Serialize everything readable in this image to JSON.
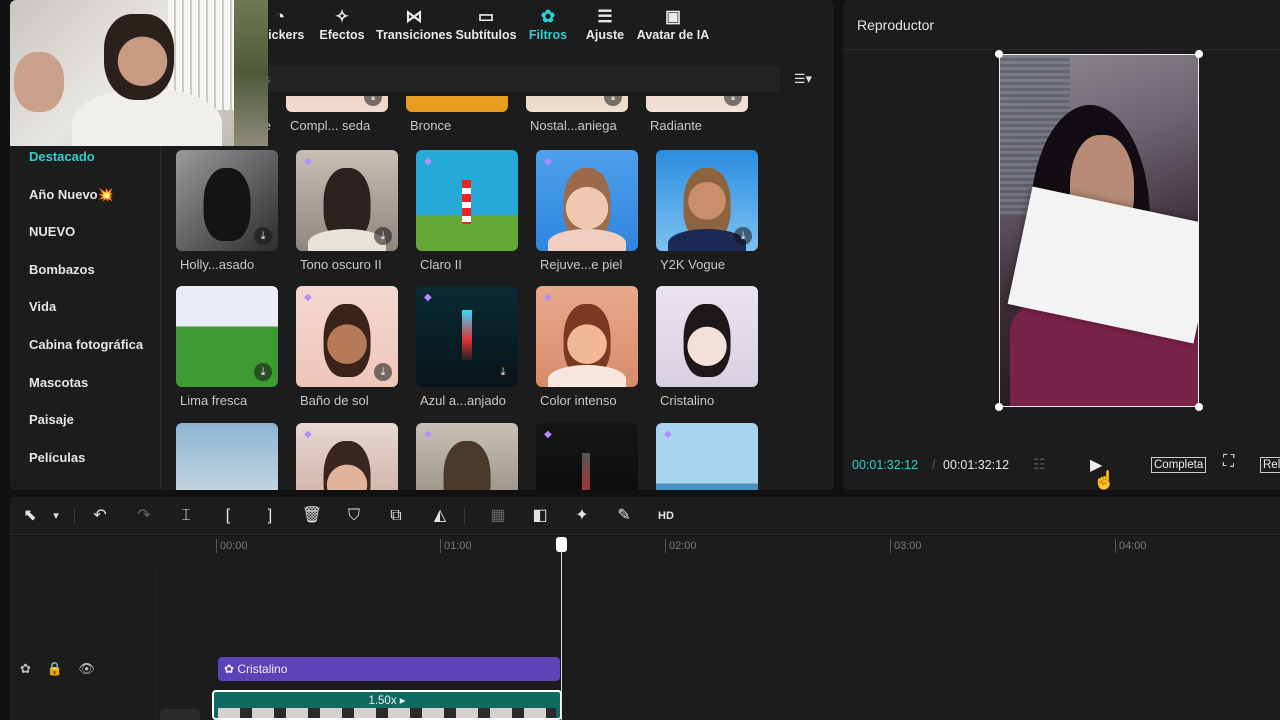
{
  "tabs": [
    {
      "label": "Stickers",
      "icon": "sticker-icon",
      "glyph": "◔"
    },
    {
      "label": "Efectos",
      "icon": "effects-icon",
      "glyph": "✧"
    },
    {
      "label": "Transiciones",
      "icon": "transitions-icon",
      "glyph": "⋈"
    },
    {
      "label": "Subtítulos",
      "icon": "subtitles-icon",
      "glyph": "▭"
    },
    {
      "label": "Filtros",
      "icon": "filters-icon",
      "glyph": "✿"
    },
    {
      "label": "Ajuste",
      "icon": "adjust-icon",
      "glyph": "☰"
    },
    {
      "label": "Avatar de IA",
      "icon": "ai-avatar-icon",
      "glyph": "▣"
    }
  ],
  "search": {
    "placeholder": "s"
  },
  "sidebar": {
    "items": [
      {
        "label": "Destacado"
      },
      {
        "label": "Año Nuevo💥"
      },
      {
        "label": "NUEVO"
      },
      {
        "label": "Bombazos"
      },
      {
        "label": "Vida"
      },
      {
        "label": "Cabina fotográfica"
      },
      {
        "label": "Mascotas"
      },
      {
        "label": "Paisaje"
      },
      {
        "label": "Películas"
      }
    ]
  },
  "filters": {
    "row0": [
      "te",
      "Compl... seda",
      "Bronce",
      "Nostal...aniega",
      "Radiante"
    ],
    "row1": [
      "Holly...asado",
      "Tono oscuro II",
      "Claro II",
      "Rejuve...e piel",
      "Y2K Vogue"
    ],
    "row2": [
      "Lima fresca",
      "Baño de sol",
      "Azul a...anjado",
      "Color intenso",
      "Cristalino"
    ]
  },
  "player": {
    "title": "Reproductor",
    "current_time": "00:01:32:12",
    "total_time": "00:01:32:12",
    "full_label": "Completa",
    "ratio_label": "Rela"
  },
  "timeline": {
    "ruler": [
      "00:00",
      "01:00",
      "02:00",
      "03:00",
      "04:00"
    ],
    "filter_clip_label": "Cristalino",
    "speed_label": "1.50x ▸"
  },
  "colors": {
    "accent": "#2fd1d0",
    "filter_clip": "#5b43b8",
    "video_clip": "#0f6b62"
  }
}
